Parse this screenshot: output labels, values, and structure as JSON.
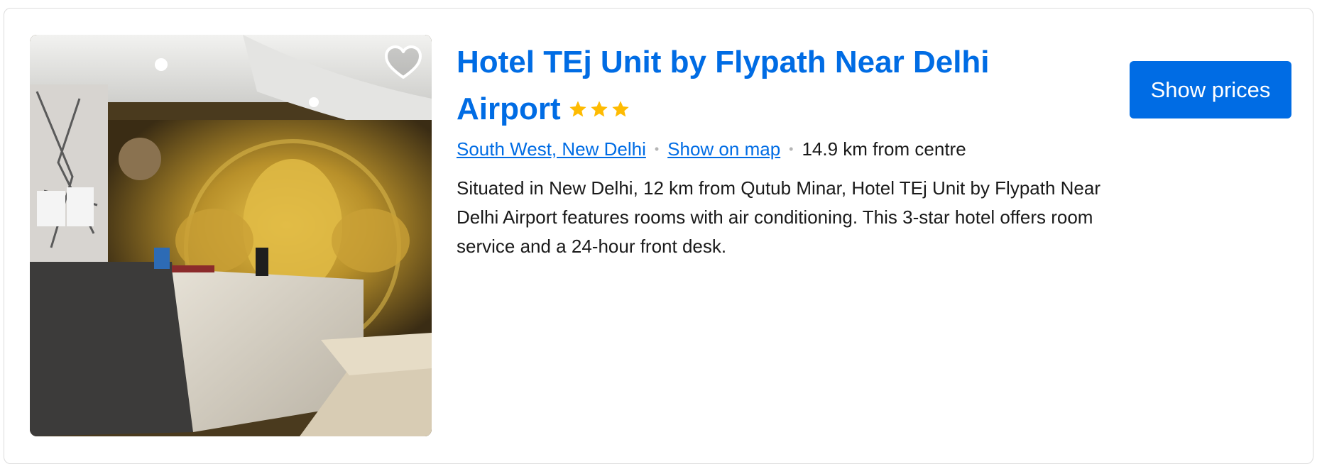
{
  "hotel": {
    "name": "Hotel TEj Unit by Flypath Near Delhi Airport",
    "star_rating": 3,
    "star_color": "#febb02",
    "location_link": "South West, New Delhi",
    "map_link": "Show on map",
    "distance": "14.9 km from centre",
    "description": "Situated in New Delhi, 12 km from Qutub Minar, Hotel TEj Unit by Flypath Near Delhi Airport features rooms with air conditioning. This 3-star hotel offers room service and a 24-hour front desk.",
    "favourite_icon": "heart-outline-icon"
  },
  "actions": {
    "show_prices_label": "Show prices"
  },
  "colors": {
    "accent": "#006ce4",
    "text": "#1a1a1a",
    "border": "#dcdcdc"
  }
}
